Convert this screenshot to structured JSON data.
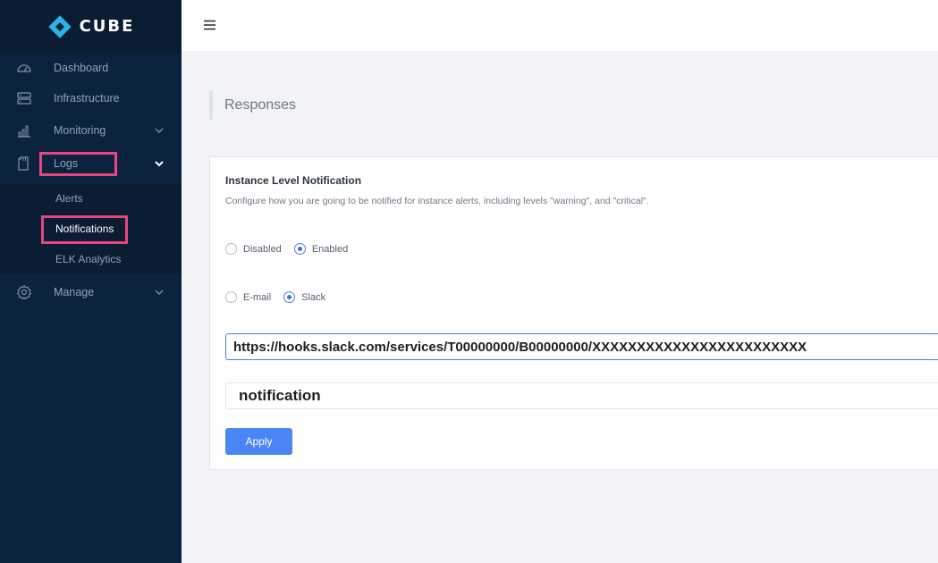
{
  "brand": {
    "name": "CUBE",
    "logo_color": "#2ab4e6"
  },
  "sidebar": {
    "items": [
      {
        "label": "Dashboard",
        "icon": "dashboard-gauge-icon"
      },
      {
        "label": "Infrastructure",
        "icon": "server-icon"
      },
      {
        "label": "Monitoring",
        "icon": "bar-chart-icon",
        "expandable": true
      },
      {
        "label": "Logs",
        "icon": "document-icon",
        "expandable": true,
        "expanded": true
      },
      {
        "label": "Manage",
        "icon": "gear-icon",
        "expandable": true
      }
    ],
    "logs_submenu": [
      {
        "label": "Alerts"
      },
      {
        "label": "Notifications",
        "active": true
      },
      {
        "label": "ELK Analytics"
      }
    ]
  },
  "topbar": {
    "menu_icon": "hamburger-menu-icon"
  },
  "page": {
    "title": "Responses"
  },
  "card": {
    "title": "Instance Level Notification",
    "description": "Configure how you are going to be notified for instance alerts, including levels \"warning\", and \"critical\".",
    "status_options": [
      {
        "label": "Disabled",
        "checked": false
      },
      {
        "label": "Enabled",
        "checked": true
      }
    ],
    "channel_options": [
      {
        "label": "E-mail",
        "checked": false
      },
      {
        "label": "Slack",
        "checked": true
      }
    ],
    "webhook_value": "https://hooks.slack.com/services/T00000000/B00000000/XXXXXXXXXXXXXXXXXXXXXXXX",
    "channel_value": "notification",
    "apply_label": "Apply"
  },
  "colors": {
    "sidebar_bg": "#0c2340",
    "highlight": "#e8457f",
    "accent": "#4a86f5"
  }
}
